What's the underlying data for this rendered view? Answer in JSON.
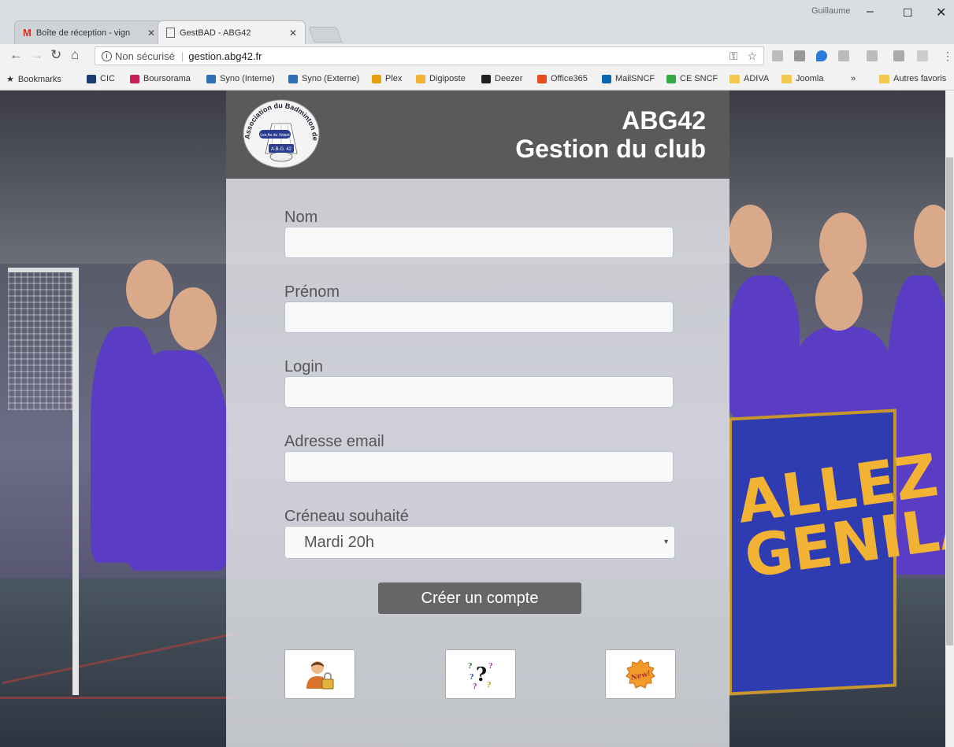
{
  "window": {
    "user": "Guillaume",
    "controls": {
      "minimize": "–",
      "maximize": "☐",
      "close": "✕"
    }
  },
  "tabs": [
    {
      "label": "Boîte de réception - vign",
      "icon": "gmail-icon",
      "active": false
    },
    {
      "label": "GestBAD - ABG42",
      "icon": "page-icon",
      "active": true
    }
  ],
  "toolbar": {
    "security": "Non sécurisé",
    "url": "gestion.abg42.fr"
  },
  "bookmarks": [
    {
      "label": "Bookmarks",
      "color": "#555555"
    },
    {
      "label": "CIC",
      "color": "#1b3b73"
    },
    {
      "label": "Boursorama",
      "color": "#c81e5a"
    },
    {
      "label": "Syno (Interne)",
      "color": "#2e6fb7"
    },
    {
      "label": "Syno (Externe)",
      "color": "#2e6fb7"
    },
    {
      "label": "Plex",
      "color": "#e5a00d"
    },
    {
      "label": "Digiposte",
      "color": "#f2b233"
    },
    {
      "label": "Deezer",
      "color": "#222222"
    },
    {
      "label": "Office365",
      "color": "#e74c1c"
    },
    {
      "label": "MailSNCF",
      "color": "#0a66b3"
    },
    {
      "label": "CE SNCF",
      "color": "#33aa44"
    },
    {
      "label": "ADIVA",
      "color": "folder"
    },
    {
      "label": "Joomla",
      "color": "folder"
    },
    {
      "label": "»",
      "color": ""
    },
    {
      "label": "Autres favoris",
      "color": "folder"
    }
  ],
  "header": {
    "title": "ABG42",
    "subtitle": "Gestion du club"
  },
  "logo": {
    "arc_text": "Association du Badminton de Genilac",
    "tagline": "Les As du Volant",
    "short": "A.B.G. 42"
  },
  "form": {
    "nom_label": "Nom",
    "nom_value": "",
    "prenom_label": "Prénom",
    "prenom_value": "",
    "login_label": "Login",
    "login_value": "",
    "email_label": "Adresse email",
    "email_value": "",
    "creneau_label": "Créneau souhaité",
    "creneau_value": "Mardi 20h",
    "submit_label": "Créer un compte"
  },
  "icons": {
    "login": "user-lock-icon",
    "help": "question-marks-icon",
    "new": "new-badge-icon",
    "new_text": "New!"
  },
  "background": {
    "banner_text": "ALLEZ GENILAC"
  },
  "colors": {
    "header_bg": "#5a5a5a",
    "button_bg": "#666666",
    "jersey": "#5b3cc4",
    "banner": "#2f3bb0",
    "banner_text": "#f2b233"
  }
}
